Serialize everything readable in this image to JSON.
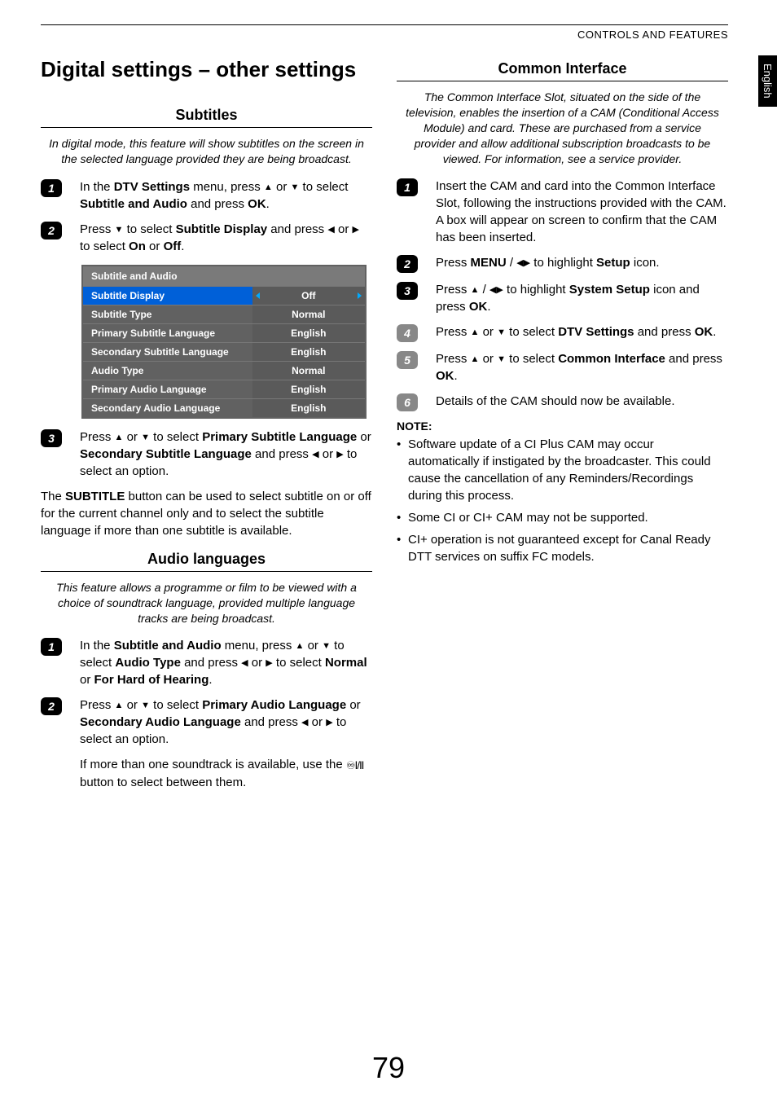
{
  "header": {
    "section": "CONTROLS AND FEATURES"
  },
  "langTab": "English",
  "pageNumber": "79",
  "left": {
    "title": "Digital settings – other settings",
    "subtitles": {
      "heading": "Subtitles",
      "intro": "In digital mode, this feature will show subtitles on the screen in the selected language provided they are being broadcast.",
      "step1_a": "In the ",
      "step1_b": "DTV Settings",
      "step1_c": " menu, press ",
      "step1_d": " or ",
      "step1_e": " to select ",
      "step1_f": "Subtitle and Audio",
      "step1_g": " and press ",
      "step1_h": "OK",
      "step1_i": ".",
      "step2_a": "Press ",
      "step2_b": " to select ",
      "step2_c": "Subtitle Display",
      "step2_d": " and press ",
      "step2_e": " or ",
      "step2_f": " to select ",
      "step2_g": "On",
      "step2_h": " or ",
      "step2_i": "Off",
      "step2_j": ".",
      "osd": {
        "title": "Subtitle and Audio",
        "rows": [
          {
            "label": "Subtitle Display",
            "value": "Off",
            "hl": true
          },
          {
            "label": "Subtitle Type",
            "value": "Normal"
          },
          {
            "label": "Primary Subtitle Language",
            "value": "English"
          },
          {
            "label": "Secondary Subtitle Language",
            "value": "English"
          },
          {
            "label": "Audio Type",
            "value": "Normal"
          },
          {
            "label": "Primary Audio Language",
            "value": "English"
          },
          {
            "label": "Secondary Audio Language",
            "value": "English"
          }
        ]
      },
      "step3_a": "Press ",
      "step3_b": " or ",
      "step3_c": " to select ",
      "step3_d": "Primary Subtitle Language",
      "step3_e": " or ",
      "step3_f": "Secondary Subtitle Language",
      "step3_g": " and press ",
      "step3_h": " or ",
      "step3_i": " to select an option.",
      "para_a": "The ",
      "para_b": "SUBTITLE",
      "para_c": " button can be used to select subtitle on or off for the current channel only and to select the subtitle language if more than one subtitle is available."
    },
    "audio": {
      "heading": "Audio languages",
      "intro": "This feature allows a programme or film to be viewed with a choice of soundtrack language, provided multiple language tracks are being broadcast.",
      "step1_a": "In the ",
      "step1_b": "Subtitle and Audio",
      "step1_c": " menu, press ",
      "step1_d": " or ",
      "step1_e": " to select ",
      "step1_f": "Audio Type",
      "step1_g": " and press ",
      "step1_h": " or ",
      "step1_i": " to select ",
      "step1_j": "Normal",
      "step1_k": " or ",
      "step1_l": "For Hard of Hearing",
      "step1_m": ".",
      "step2_a": "Press ",
      "step2_b": " or ",
      "step2_c": " to select ",
      "step2_d": "Primary Audio Language",
      "step2_e": " or ",
      "step2_f": "Secondary Audio Language",
      "step2_g": " and press ",
      "step2_h": " or ",
      "step2_i": " to select an option.",
      "para_a": "If more than one soundtrack is available, use the ",
      "para_b": " button to select between them."
    }
  },
  "right": {
    "heading": "Common Interface",
    "intro": "The Common Interface Slot, situated on the side of the television, enables the insertion of a CAM (Conditional Access Module) and card. These are purchased from a service provider and allow additional subscription broadcasts to be viewed. For information, see a service provider.",
    "step1": "Insert the CAM and card into the Common Interface Slot, following the instructions provided with the CAM. A box will appear on screen to confirm that the CAM has been inserted.",
    "step2_a": "Press ",
    "step2_b": "MENU",
    "step2_c": " / ",
    "step2_d": " to highlight ",
    "step2_e": "Setup",
    "step2_f": " icon.",
    "step3_a": "Press ",
    "step3_b": " / ",
    "step3_c": " to highlight ",
    "step3_d": "System Setup",
    "step3_e": " icon and press ",
    "step3_f": "OK",
    "step3_g": ".",
    "step4_a": "Press ",
    "step4_b": " or ",
    "step4_c": " to select ",
    "step4_d": "DTV Settings",
    "step4_e": " and press ",
    "step4_f": "OK",
    "step4_g": ".",
    "step5_a": "Press ",
    "step5_b": " or ",
    "step5_c": " to select ",
    "step5_d": "Common Interface",
    "step5_e": " and press ",
    "step5_f": "OK",
    "step5_g": ".",
    "step6": "Details of the CAM should now be available.",
    "noteLabel": "NOTE:",
    "notes": [
      "Software update of a CI Plus CAM may occur automatically if instigated by the broadcaster. This could cause the cancellation of any Reminders/Recordings during this process.",
      "Some CI or CI+ CAM may not be supported.",
      "CI+ operation is not guaranteed except for Canal Ready DTT services on suffix FC models."
    ]
  }
}
